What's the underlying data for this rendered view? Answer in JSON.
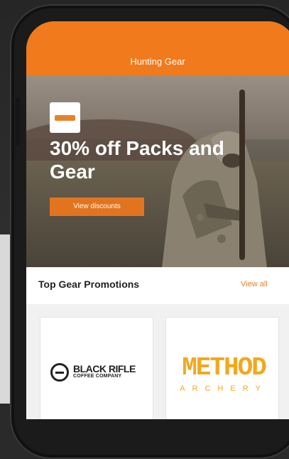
{
  "header": {
    "title": "Hunting Gear"
  },
  "hero": {
    "headline": "30% off Packs and Gear",
    "button_label": "View discounts"
  },
  "promotions": {
    "title": "Top Gear Promotions",
    "view_all_label": "View all",
    "brands": [
      {
        "name": "BLACK RIFLE",
        "subtitle": "COFFEE COMPANY"
      },
      {
        "name": "METHOD",
        "subtitle": "ARCHERY"
      }
    ]
  },
  "colors": {
    "accent": "#f07a1c",
    "method_gold": "#f2a81d"
  }
}
